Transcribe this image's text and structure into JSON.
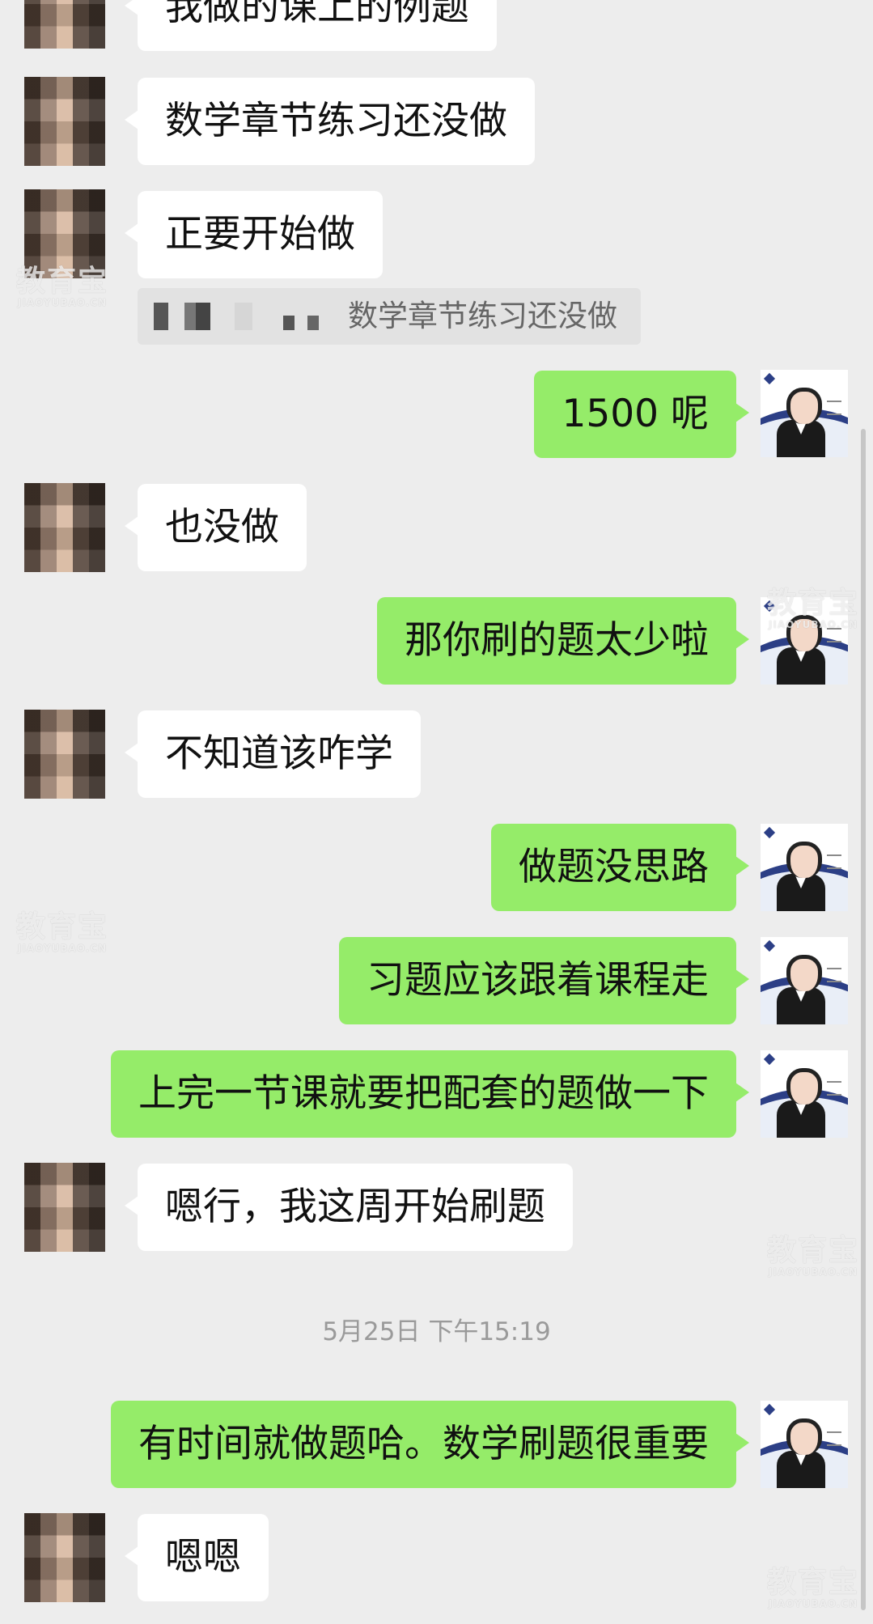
{
  "messages": [
    {
      "side": "left",
      "text": "我做的课上的例题"
    },
    {
      "side": "left",
      "text": "数学章节练习还没做"
    },
    {
      "side": "left",
      "text": "正要开始做"
    },
    {
      "side": "right",
      "text": "1500 呢"
    },
    {
      "side": "left",
      "text": "也没做"
    },
    {
      "side": "right",
      "text": "那你刷的题太少啦"
    },
    {
      "side": "left",
      "text": "不知道该咋学"
    },
    {
      "side": "right",
      "text": "做题没思路"
    },
    {
      "side": "right",
      "text": "习题应该跟着课程走"
    },
    {
      "side": "right",
      "text": "上完一节课就要把配套的题做一下"
    },
    {
      "side": "left",
      "text": "嗯行，我这周开始刷题"
    },
    {
      "side": "right",
      "text": "有时间就做题哈。数学刷题很重要"
    },
    {
      "side": "left",
      "text": "嗯嗯"
    }
  ],
  "quote": {
    "text": "数学章节练习还没做"
  },
  "timestamp": "5月25日 下午15:19",
  "watermark": {
    "cn": "教育宝",
    "en": "JIAOYUBAO.CN"
  },
  "colors": {
    "background": "#ededed",
    "bubble_self": "#95ec69",
    "bubble_other": "#ffffff"
  }
}
